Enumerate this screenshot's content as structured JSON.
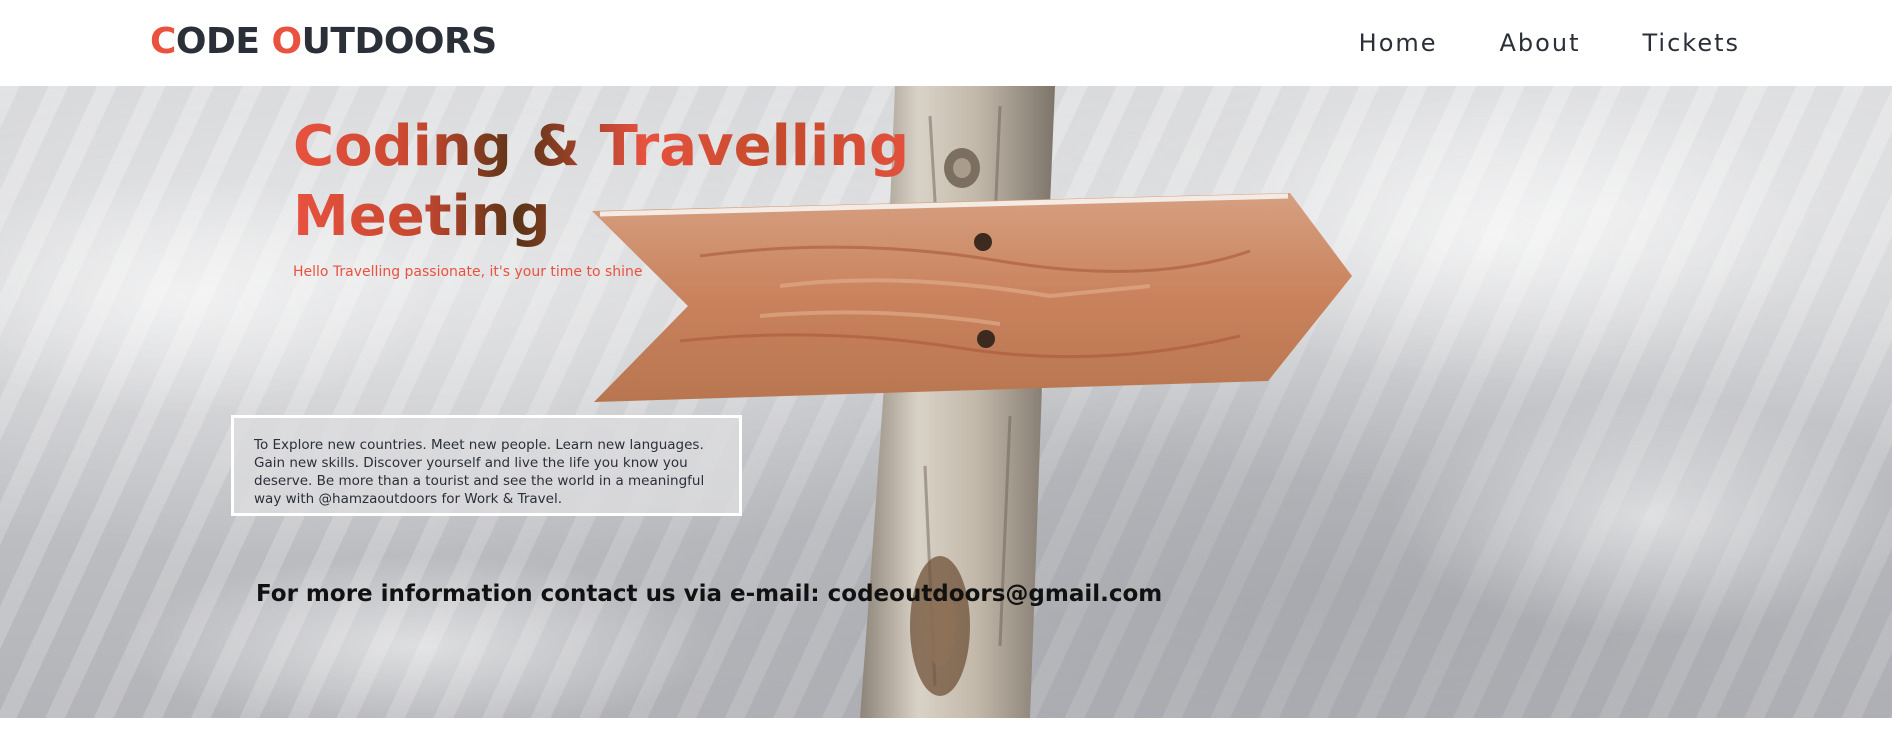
{
  "header": {
    "logo": {
      "c_letter": "C",
      "ode": "ODE ",
      "o_letter": "O",
      "utdoors": "UTDOORS"
    },
    "nav": [
      {
        "label": "Home"
      },
      {
        "label": "About"
      },
      {
        "label": "Tickets"
      }
    ]
  },
  "hero": {
    "title": "Coding & Travelling Meeting",
    "subtitle": "Hello Travelling passionate, it's your time to shine",
    "description": "To Explore new countries. Meet new people. Learn new languages. Gain new skills. Discover yourself and live the life you know you deserve. Be more than a tourist and see the world in a meaningful way with @hamzaoutdoors for Work & Travel.",
    "contact": "For more information contact us via e-mail: codeoutdoors@gmail.com",
    "background_image": "wooden-signpost-snow"
  },
  "colors": {
    "accent": "#e8523f",
    "text_dark": "#2b2f38",
    "background": "#ffffff"
  }
}
